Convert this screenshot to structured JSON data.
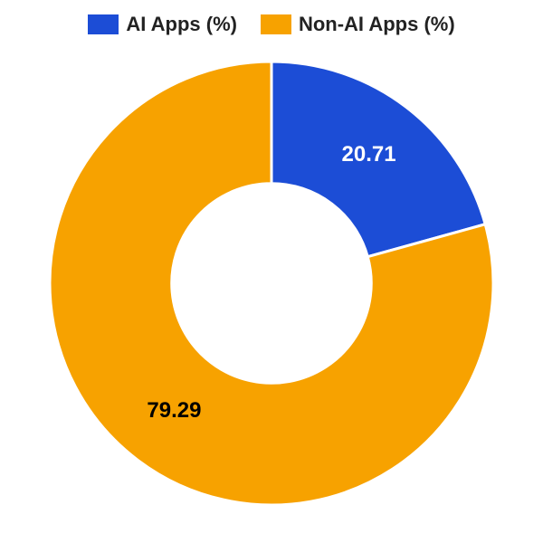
{
  "legend": {
    "items": [
      {
        "label": "AI Apps (%)",
        "color": "#1c4dd6"
      },
      {
        "label": "Non-AI Apps (%)",
        "color": "#f7a200"
      }
    ]
  },
  "chart_data": {
    "type": "pie",
    "title": "",
    "slices": [
      {
        "name": "AI Apps (%)",
        "value": 20.71,
        "color": "#1c4dd6",
        "label_color": "#ffffff"
      },
      {
        "name": "Non-AI Apps (%)",
        "value": 79.29,
        "color": "#f7a200",
        "label_color": "#000000"
      }
    ],
    "donut_inner_ratio": 0.45,
    "start_angle_deg": 0
  }
}
